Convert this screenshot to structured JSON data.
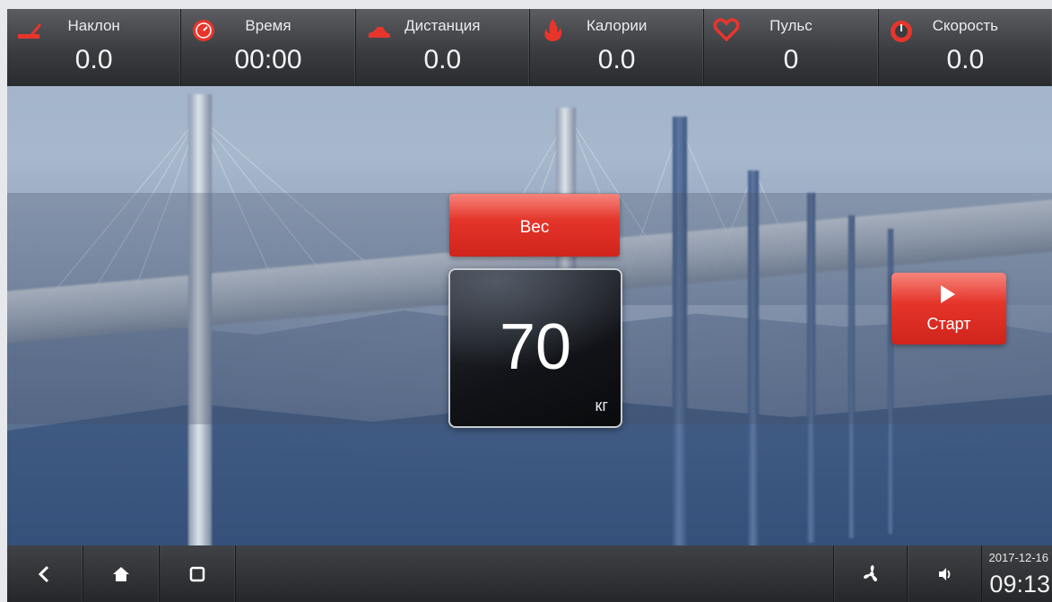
{
  "stats": [
    {
      "label": "Наклон",
      "value": "0.0",
      "icon": "incline-icon"
    },
    {
      "label": "Время",
      "value": "00:00",
      "icon": "clock-icon"
    },
    {
      "label": "Дистанция",
      "value": "0.0",
      "icon": "shoe-icon"
    },
    {
      "label": "Калории",
      "value": "0.0",
      "icon": "flame-icon"
    },
    {
      "label": "Пульс",
      "value": "0",
      "icon": "heart-icon"
    },
    {
      "label": "Скорость",
      "value": "0.0",
      "icon": "speedometer-icon"
    }
  ],
  "weight": {
    "title": "Вес",
    "value": "70",
    "unit": "кг"
  },
  "start_button": {
    "label": "Старт",
    "icon": "play-icon"
  },
  "navbar": {
    "buttons": [
      {
        "name": "back",
        "icon": "back-icon"
      },
      {
        "name": "home",
        "icon": "home-icon"
      },
      {
        "name": "recents",
        "icon": "recent-apps-icon"
      },
      {
        "name": "fan",
        "icon": "fan-icon"
      },
      {
        "name": "volume",
        "icon": "volume-icon"
      }
    ],
    "date": "2017-12-16",
    "time": "09:13"
  },
  "colors": {
    "accent_red": "#e4342a",
    "bar_dark": "#2a2b2f",
    "icon_red": "#e8352c"
  }
}
